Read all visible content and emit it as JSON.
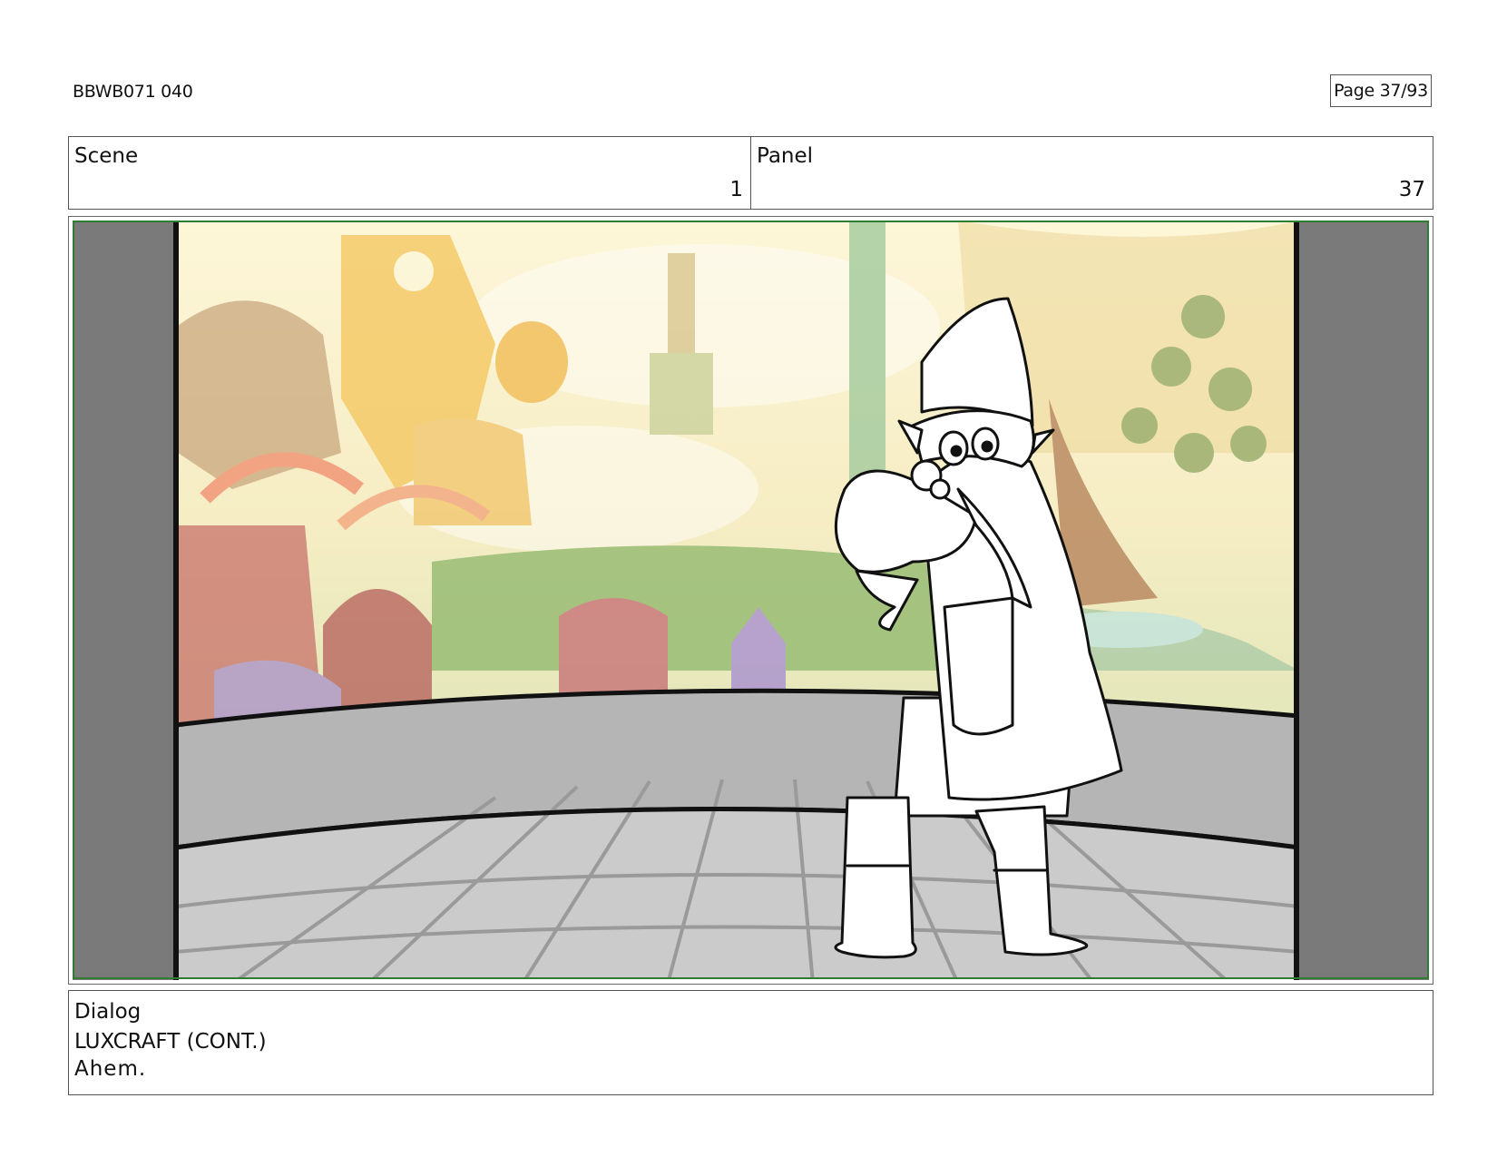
{
  "header": {
    "doc_id": "BBWB071 040",
    "page": "Page 37/93"
  },
  "scene": {
    "label": "Scene",
    "value": "1"
  },
  "panel": {
    "label": "Panel",
    "value": "37"
  },
  "artwork": {
    "frame_color": "#2e7d32",
    "letterbox_color": "#7a7a7a",
    "floor_color": "#c9c9c9",
    "wall_color": "#b5b5b5"
  },
  "dialog": {
    "label": "Dialog",
    "speaker": "LUXCRAFT (CONT.)",
    "line": "Ahem."
  }
}
